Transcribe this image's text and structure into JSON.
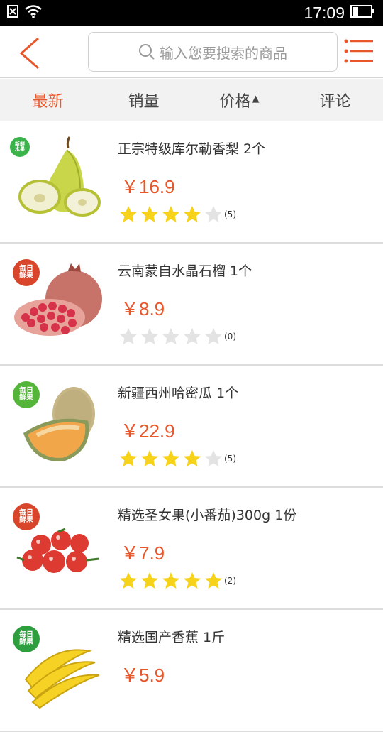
{
  "status": {
    "time": "17:09"
  },
  "search": {
    "placeholder": "输入您要搜索的商品"
  },
  "tabs": [
    {
      "label": "最新",
      "active": true
    },
    {
      "label": "销量",
      "active": false
    },
    {
      "label": "价格",
      "active": false,
      "arrow": "▲"
    },
    {
      "label": "评论",
      "active": false
    }
  ],
  "colors": {
    "accent": "#e8562a",
    "star_on": "#f7d21b",
    "star_off": "#e3e3e3",
    "badge_green": "#3cb34a",
    "badge_red": "#d9452b"
  },
  "products": [
    {
      "name": "正宗特级库尔勒香梨 2个",
      "price": "￥16.9",
      "stars": 4,
      "count": "(5)",
      "badge": {
        "line1": "新鲜",
        "line2": "水果",
        "color": "#3cb34a",
        "size": "small"
      },
      "image": "pear-icon"
    },
    {
      "name": "云南蒙自水晶石榴 1个",
      "price": "￥8.9",
      "stars": 0,
      "count": "(0)",
      "badge": {
        "line1": "每日",
        "line2": "鲜果",
        "color": "#d9452b",
        "size": "big"
      },
      "image": "pomegranate-icon"
    },
    {
      "name": "新疆西州哈密瓜 1个",
      "price": "￥22.9",
      "stars": 4,
      "count": "(5)",
      "badge": {
        "line1": "每日",
        "line2": "鲜果",
        "color": "#55b53a",
        "size": "big"
      },
      "image": "melon-icon"
    },
    {
      "name": "精选圣女果(小番茄)300g 1份",
      "price": "￥7.9",
      "stars": 5,
      "count": "(2)",
      "badge": {
        "line1": "每日",
        "line2": "鲜果",
        "color": "#d9452b",
        "size": "big"
      },
      "image": "tomato-icon"
    },
    {
      "name": "精选国产香蕉 1斤",
      "price": "￥5.9",
      "stars": 0,
      "count": "",
      "badge": {
        "line1": "每日",
        "line2": "鲜果",
        "color": "#2f9e3e",
        "size": "big"
      },
      "image": "banana-icon"
    }
  ]
}
